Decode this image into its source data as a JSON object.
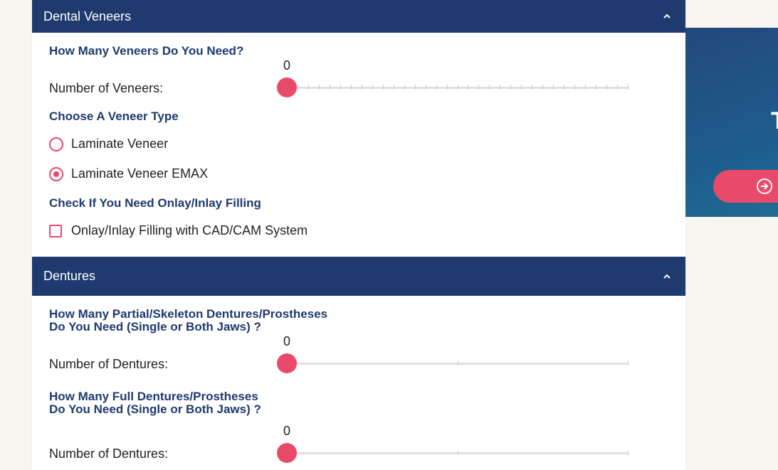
{
  "veneers": {
    "header": "Dental Veneers",
    "question": "How Many Veneers Do You Need?",
    "slider_value": "0",
    "slider_label": "Number of Veneers:",
    "type_title": "Choose A Veneer Type",
    "options": [
      {
        "label": "Laminate Veneer",
        "selected": false
      },
      {
        "label": "Laminate Veneer EMAX",
        "selected": true
      }
    ],
    "filling_title": "Check If You Need Onlay/Inlay Filling",
    "filling_option": "Onlay/Inlay Filling with CAD/CAM System"
  },
  "dentures": {
    "header": "Dentures",
    "partial_question_line1": "How Many Partial/Skeleton Dentures/Prostheses",
    "partial_question_line2": "Do You Need (Single or Both Jaws) ?",
    "partial_value": "0",
    "partial_label": "Number of Dentures:",
    "full_question_line1": "How Many Full Dentures/Prostheses",
    "full_question_line2": "Do You Need (Single or Both Jaws) ?",
    "full_value": "0",
    "full_label": "Number of Dentures:"
  },
  "sidebar": {
    "partial_text": "T"
  },
  "colors": {
    "header_bg": "#1e3a6e",
    "accent": "#e94a6a",
    "title": "#1e3a6e"
  },
  "icons": {
    "collapse": "chevron-up-icon",
    "sidebar_button": "arrow-circle-right-icon"
  }
}
